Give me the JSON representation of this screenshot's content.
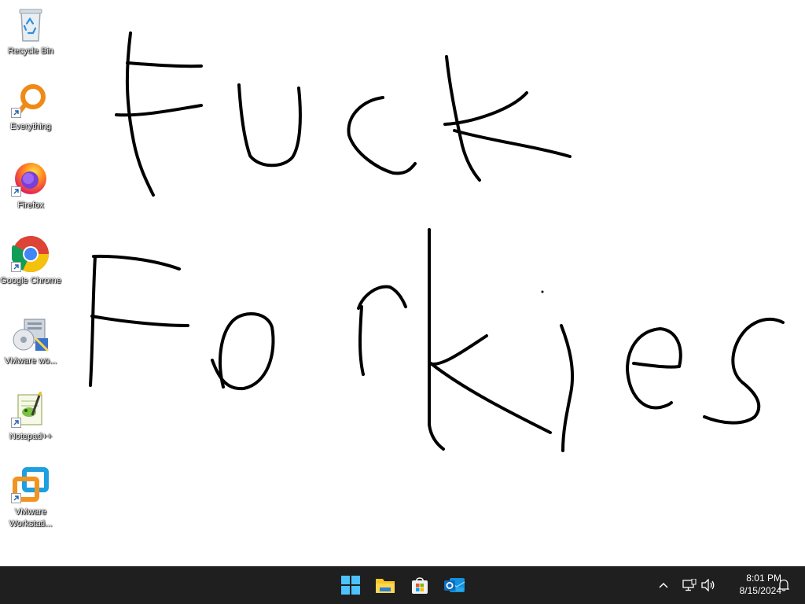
{
  "desktop": {
    "icons": [
      {
        "label": "Recycle Bin",
        "icon": "recycle-bin-icon"
      },
      {
        "label": "Everything",
        "icon": "everything-search-icon"
      },
      {
        "label": "Firefox",
        "icon": "firefox-icon"
      },
      {
        "label": "Google Chrome",
        "icon": "chrome-icon"
      },
      {
        "label": "VMware wo...",
        "icon": "vmware-installer-icon"
      },
      {
        "label": "Notepad++",
        "icon": "notepadpp-icon"
      },
      {
        "label": "VMware Workstati...",
        "icon": "vmware-workstation-icon"
      }
    ],
    "wallpaper_color": "#ffffff",
    "drawing": {
      "stroke_color": "#000000",
      "strokes": [
        "Fuck",
        "Forkies"
      ]
    }
  },
  "taskbar": {
    "background": "#1f1f1f",
    "pinned": [
      {
        "name": "start-button",
        "icon": "windows-logo-icon"
      },
      {
        "name": "file-explorer-button",
        "icon": "folder-icon"
      },
      {
        "name": "microsoft-store-button",
        "icon": "store-icon"
      },
      {
        "name": "outlook-button",
        "icon": "outlook-icon"
      }
    ],
    "tray": {
      "show_hidden_icon": "chevron-up-icon",
      "network_icon": "network-icon",
      "volume_icon": "speaker-icon",
      "notification_icon": "bell-icon"
    },
    "clock": {
      "time": "8:01 PM",
      "date": "8/15/2024"
    }
  }
}
